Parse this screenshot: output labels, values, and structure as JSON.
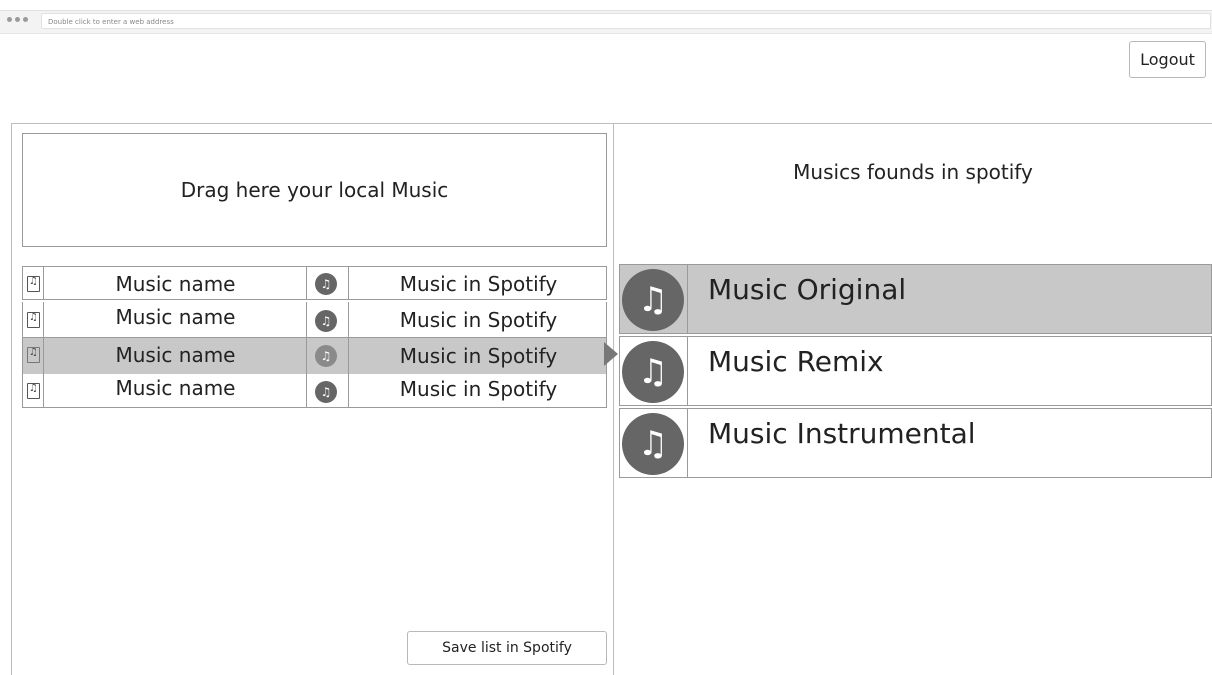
{
  "browser": {
    "address_placeholder": "Double click to enter a web address"
  },
  "header": {
    "logout_label": "Logout"
  },
  "left": {
    "dropzone_text": "Drag here your local Music",
    "rows": [
      {
        "name": "Music name",
        "spotify": "Music in Spotify",
        "selected": false
      },
      {
        "name": "Music name",
        "spotify": "Music in Spotify",
        "selected": false
      },
      {
        "name": "Music name",
        "spotify": "Music in Spotify",
        "selected": true
      },
      {
        "name": "Music name",
        "spotify": "Music in Spotify",
        "selected": false
      }
    ],
    "save_label": "Save list in Spotify"
  },
  "right": {
    "title": "Musics founds in spotify",
    "results": [
      {
        "label": "Music Original",
        "selected": true
      },
      {
        "label": "Music Remix",
        "selected": false
      },
      {
        "label": "Music Instrumental",
        "selected": false
      }
    ]
  },
  "icons": {
    "file": "music-file-icon",
    "spotify": "music-note-icon"
  },
  "colors": {
    "selected_bg": "#c8c8c8",
    "icon_circle": "#666666",
    "border": "#9a9a9a"
  }
}
